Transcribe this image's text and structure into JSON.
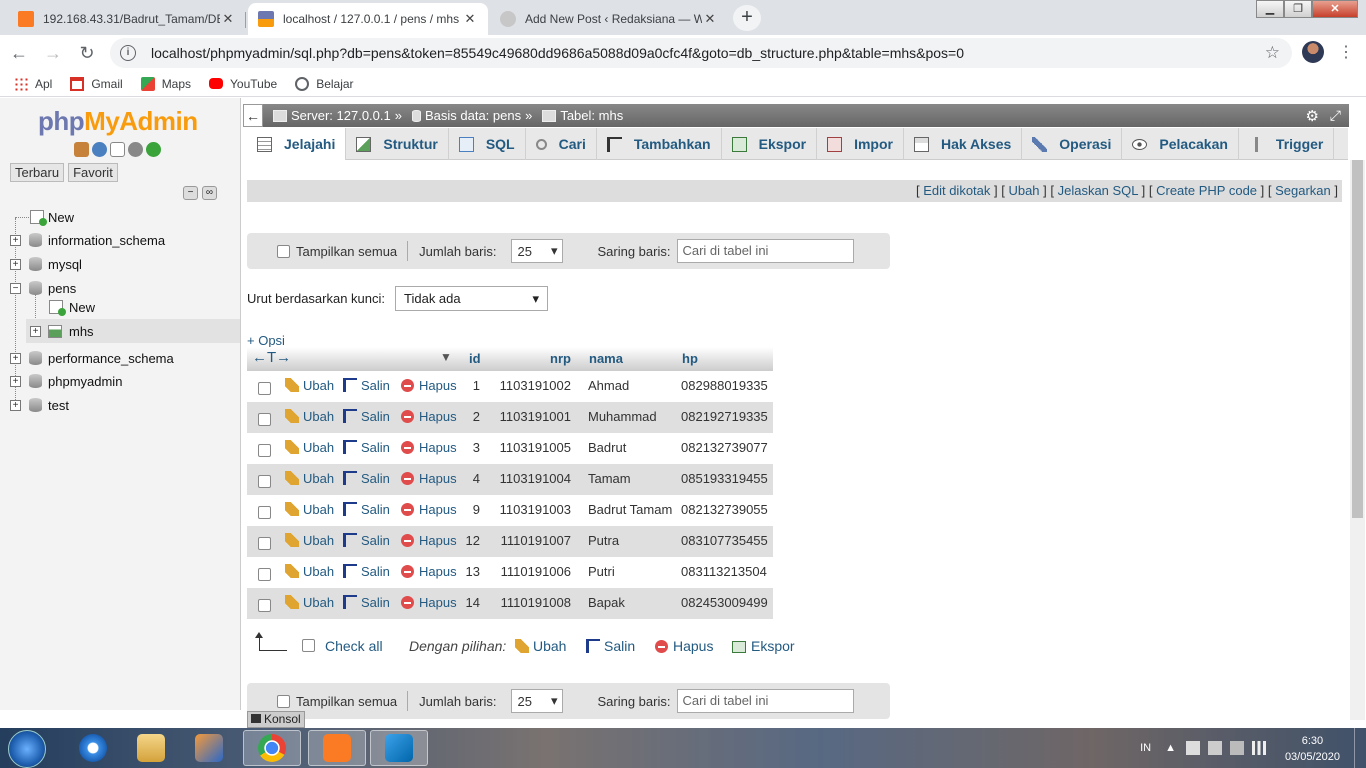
{
  "browser": {
    "tabs": [
      {
        "title": "192.168.43.31/Badrut_Tamam/DB",
        "icon": "xampp-icon"
      },
      {
        "title": "localhost / 127.0.0.1 / pens / mhs",
        "icon": "phpmyadmin-icon"
      },
      {
        "title": "Add New Post ‹ Redaksiana — W",
        "icon": "wordpress-icon"
      }
    ],
    "url": "localhost/phpmyadmin/sql.php?db=pens&token=85549c49680dd9686a5088d09a0cfc4f&goto=db_structure.php&table=mhs&pos=0",
    "bookmarks": [
      "Apl",
      "Gmail",
      "Maps",
      "YouTube",
      "Belajar"
    ]
  },
  "pma": {
    "logo_php": "php",
    "logo_myadmin": "MyAdmin",
    "left_tabs": [
      "Terbaru",
      "Favorit"
    ],
    "tree": [
      {
        "label": "New",
        "level": 0
      },
      {
        "label": "information_schema",
        "level": 0
      },
      {
        "label": "mysql",
        "level": 0
      },
      {
        "label": "pens",
        "level": 0
      },
      {
        "label": "New",
        "level": 1
      },
      {
        "label": "mhs",
        "level": 1
      },
      {
        "label": "performance_schema",
        "level": 0
      },
      {
        "label": "phpmyadmin",
        "level": 0
      },
      {
        "label": "test",
        "level": 0
      }
    ],
    "breadcrumb": {
      "server": "Server: 127.0.0.1",
      "db": "Basis data: pens",
      "table": "Tabel: mhs"
    },
    "menu": [
      "Jelajahi",
      "Struktur",
      "SQL",
      "Cari",
      "Tambahkan",
      "Ekspor",
      "Impor",
      "Hak Akses",
      "Operasi",
      "Pelacakan",
      "Trigger"
    ],
    "links": [
      "Edit dikotak",
      "Ubah",
      "Jelaskan SQL",
      "Create PHP code",
      "Segarkan"
    ],
    "nav": {
      "show_all": "Tampilkan semua",
      "rows_label": "Jumlah baris:",
      "rows_value": "25",
      "filter_label": "Saring baris:",
      "filter_placeholder": "Cari di tabel ini"
    },
    "sort_label": "Urut berdasarkan kunci:",
    "sort_value": "Tidak ada",
    "opsi": "+ Opsi",
    "arrows": "←T→",
    "columns": [
      "id",
      "nrp",
      "nama",
      "hp"
    ],
    "actions": {
      "edit": "Ubah",
      "copy": "Salin",
      "delete": "Hapus"
    },
    "rows": [
      {
        "id": "1",
        "nrp": "1103191002",
        "nama": "Ahmad",
        "hp": "082988019335"
      },
      {
        "id": "2",
        "nrp": "1103191001",
        "nama": "Muhammad",
        "hp": "082192719335"
      },
      {
        "id": "3",
        "nrp": "1103191005",
        "nama": "Badrut",
        "hp": "082132739077"
      },
      {
        "id": "4",
        "nrp": "1103191004",
        "nama": "Tamam",
        "hp": "085193319455"
      },
      {
        "id": "9",
        "nrp": "1103191003",
        "nama": "Badrut Tamam",
        "hp": "082132739055"
      },
      {
        "id": "12",
        "nrp": "1110191007",
        "nama": "Putra",
        "hp": "083107735455"
      },
      {
        "id": "13",
        "nrp": "1110191006",
        "nama": "Putri",
        "hp": "083113213504"
      },
      {
        "id": "14",
        "nrp": "1110191008",
        "nama": "Bapak",
        "hp": "082453009499"
      }
    ],
    "bulk": {
      "check_all": "Check all",
      "with_selected": "Dengan pilihan:",
      "edit": "Ubah",
      "copy": "Salin",
      "delete": "Hapus",
      "export": "Ekspor"
    },
    "console": "Konsol"
  },
  "taskbar": {
    "lang": "IN",
    "time": "6:30",
    "date": "03/05/2020"
  },
  "colors": {
    "link": "#235a81",
    "logo_php": "#6c78af",
    "logo_myadmin": "#f89c0e"
  }
}
